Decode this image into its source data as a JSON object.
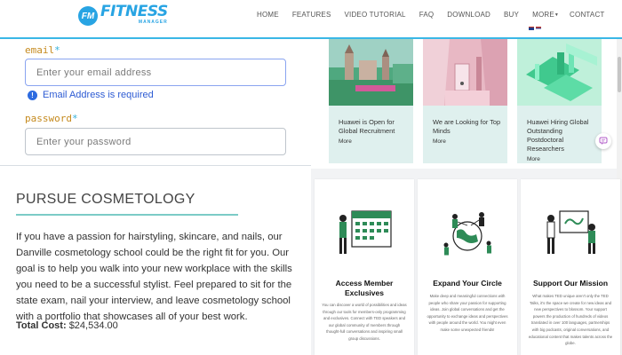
{
  "brand": {
    "badge": "FM",
    "name": "FITNESS",
    "sub": "MANAGER"
  },
  "nav": {
    "items": [
      "HOME",
      "FEATURES",
      "VIDEO TUTORIAL",
      "FAQ",
      "DOWNLOAD",
      "BUY"
    ],
    "more": "MORE",
    "contact": "CONTACT"
  },
  "form": {
    "email_label": "email",
    "email_placeholder": "Enter your email address",
    "email_error": "Email Address is required",
    "password_label": "password",
    "password_placeholder": "Enter your password",
    "required_mark": "*"
  },
  "cosmetology": {
    "title": "PURSUE COSMETOLOGY",
    "body": "If you have a passion for hairstyling, skincare, and nails, our Danville cosmetology school could be the right fit for you. Our goal is to help you walk into your new workplace with the skills you need to be a successful stylist. Feel prepared to sit for the state exam, nail your interview, and leave cosmetology school with a portfolio that showcases all of your best work.",
    "total_label": "Total Cost:",
    "total_value": "$24,534.00"
  },
  "news": [
    {
      "title": "Huawei is Open for Global Recruitment",
      "more": "More"
    },
    {
      "title": "We are Looking for Top Minds",
      "more": "More"
    },
    {
      "title": "Huawei Hiring Global Outstanding Postdoctoral Researchers",
      "more": "More"
    }
  ],
  "features": [
    {
      "title": "Access Member Exclusives",
      "text": "You can discover a world of possibilities and ideas through our tools for members-only programming and exclusives. Connect with TED speakers and our global community of members through thought-full conversations and inspiring small group discussions."
    },
    {
      "title": "Expand Your Circle",
      "text": "Make deep and meaningful connections with people who share your passion for supporting ideas. Join global conversations and get the opportunity to exchange ideas and perspectives with people around the world. You might even make some unexpected friends!"
    },
    {
      "title": "Support Our Mission",
      "text": "What makes TED unique aren't only the TED Talks, it's the space we create for new ideas and new perspectives to blossom. Your support powers the production of hundreds of videos translated in over 100 languages, partnerships with big podcasts, original conversations, and educational content that makes talents across the globe."
    }
  ],
  "colors": {
    "brand": "#28a4e3",
    "accent_line": "#7ccbc7",
    "error": "#2d5bd3",
    "label": "#c58a1e"
  }
}
